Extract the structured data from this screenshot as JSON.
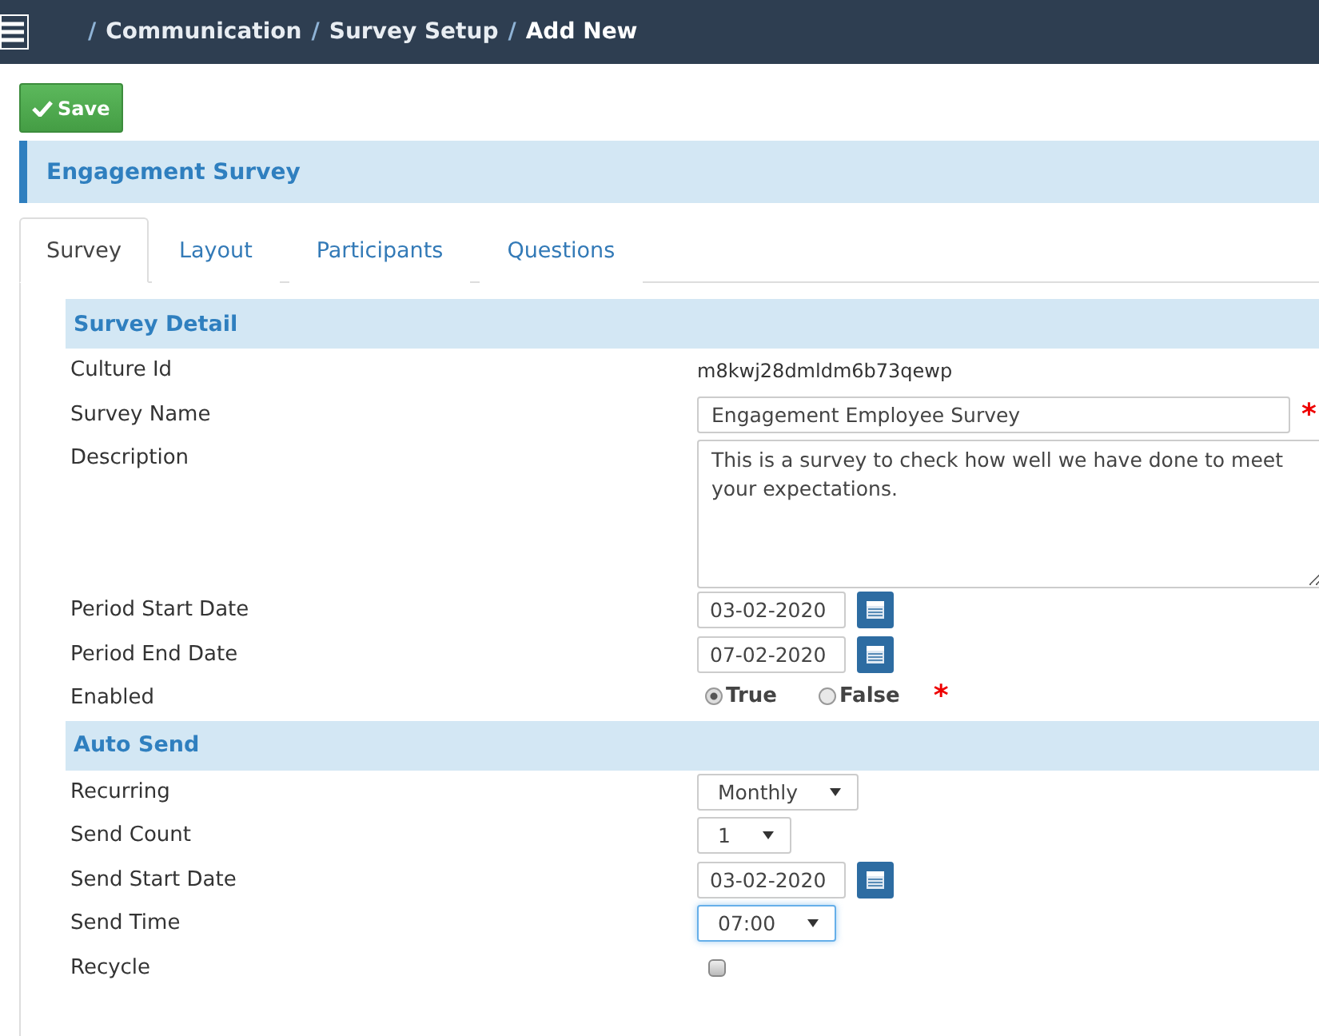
{
  "breadcrumb": [
    {
      "separator": "/",
      "label": "Communication",
      "current": false
    },
    {
      "separator": "/",
      "label": "Survey Setup",
      "current": false
    },
    {
      "separator": "/",
      "label": "Add New",
      "current": true
    }
  ],
  "save_button": {
    "label": "Save"
  },
  "title": "Engagement Survey",
  "tabs": [
    {
      "label": "Survey",
      "selected": true
    },
    {
      "label": "Layout",
      "selected": false
    },
    {
      "label": "Participants",
      "selected": false
    },
    {
      "label": "Questions",
      "selected": false
    }
  ],
  "sections": [
    {
      "title": "Survey Detail",
      "rows": [
        {
          "kind": "text",
          "label": "Culture Id",
          "value": "m8kwj28dmldm6b73qewp"
        },
        {
          "kind": "input",
          "label": "Survey Name",
          "value": "Engagement Employee Survey",
          "required_mark": "*"
        },
        {
          "kind": "textarea",
          "label": "Description",
          "value": "This is a survey to check how well we have done to meet your expectations."
        },
        {
          "kind": "date",
          "label": "Period Start Date",
          "value": "03-02-2020"
        },
        {
          "kind": "date",
          "label": "Period End Date",
          "value": "07-02-2020"
        },
        {
          "kind": "radio",
          "label": "Enabled",
          "required_mark": "*",
          "options": [
            {
              "label": "True",
              "selected": true
            },
            {
              "label": "False",
              "selected": false
            }
          ]
        }
      ]
    },
    {
      "title": "Auto Send",
      "rows": [
        {
          "kind": "select",
          "label": "Recurring",
          "value": "Monthly",
          "focused": false
        },
        {
          "kind": "select",
          "label": "Send Count",
          "value": "1",
          "focused": false
        },
        {
          "kind": "date",
          "label": "Send Start Date",
          "value": "03-02-2020"
        },
        {
          "kind": "select",
          "label": "Send Time",
          "value": "07:00",
          "focused": true
        },
        {
          "kind": "checkbox",
          "label": "Recycle",
          "checked": false
        }
      ]
    }
  ]
}
